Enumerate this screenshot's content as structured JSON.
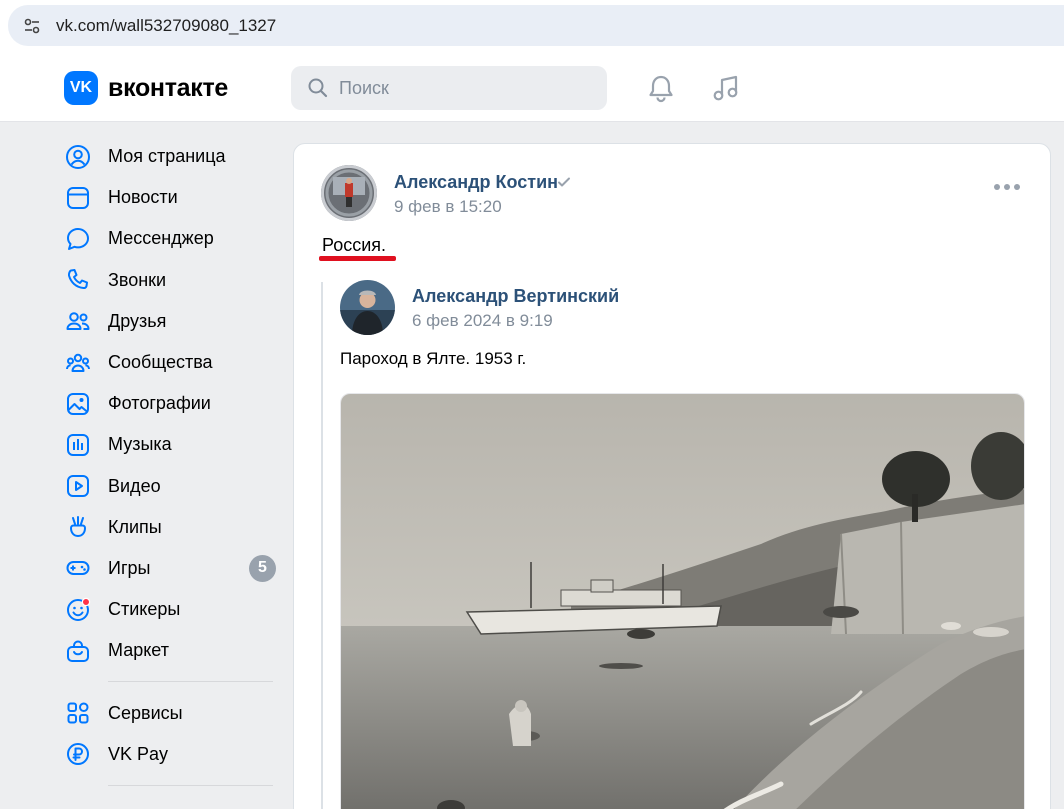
{
  "browser": {
    "url": "vk.com/wall532709080_1327"
  },
  "header": {
    "logo_text": "вконтакте",
    "logo_mark": "VK",
    "search_placeholder": "Поиск"
  },
  "sidebar": {
    "items": [
      {
        "label": "Моя страница",
        "icon": "user-circle-icon"
      },
      {
        "label": "Новости",
        "icon": "news-icon"
      },
      {
        "label": "Мессенджер",
        "icon": "message-icon"
      },
      {
        "label": "Звонки",
        "icon": "phone-icon"
      },
      {
        "label": "Друзья",
        "icon": "friends-icon"
      },
      {
        "label": "Сообщества",
        "icon": "communities-icon"
      },
      {
        "label": "Фотографии",
        "icon": "photos-icon"
      },
      {
        "label": "Музыка",
        "icon": "music-icon"
      },
      {
        "label": "Видео",
        "icon": "video-icon"
      },
      {
        "label": "Клипы",
        "icon": "clips-icon"
      },
      {
        "label": "Игры",
        "icon": "gamepad-icon",
        "badge": "5"
      },
      {
        "label": "Стикеры",
        "icon": "sticker-icon"
      },
      {
        "label": "Маркет",
        "icon": "market-icon"
      }
    ],
    "extra": [
      {
        "label": "Сервисы",
        "icon": "services-icon"
      },
      {
        "label": "VK Pay",
        "icon": "vkpay-icon"
      }
    ]
  },
  "post": {
    "author": "Александр Костин",
    "date": "9 фев в 15:20",
    "text": "Россия.",
    "repost": {
      "author": "Александр Вертинский",
      "date": "6 фев 2024 в 9:19",
      "text": "Пароход в Ялте. 1953 г."
    }
  },
  "colors": {
    "accent": "#0077ff",
    "author_link": "#2c5178",
    "secondary_text": "#818c99",
    "underline_mark": "#e0101f"
  }
}
